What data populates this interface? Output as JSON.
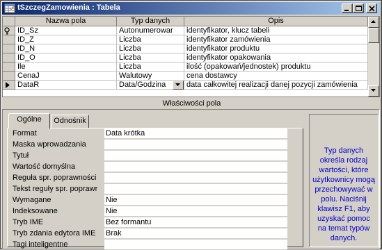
{
  "window": {
    "title": "tSzczegZamowienia : Tabela"
  },
  "grid": {
    "headers": [
      "Nazwa pola",
      "Typ danych",
      "Opis"
    ],
    "rows": [
      {
        "name": "ID_Sz",
        "type": "Autonumerowar",
        "desc": "identyfikator, klucz tabeli",
        "selector": "key-icon"
      },
      {
        "name": "ID_Z",
        "type": "Liczba",
        "desc": "identyfikator zamówienia",
        "selector": ""
      },
      {
        "name": "ID_N",
        "type": "Liczba",
        "desc": "identyfikator produktu",
        "selector": ""
      },
      {
        "name": "ID_O",
        "type": "Liczba",
        "desc": "identyfikator opakowania",
        "selector": ""
      },
      {
        "name": "Ile",
        "type": "Liczba",
        "desc": "ilość (opakowań/jednostek) produktu",
        "selector": ""
      },
      {
        "name": "CenaJ",
        "type": "Walutowy",
        "desc": "cena dostawcy",
        "selector": ""
      },
      {
        "name": "DataR",
        "type": "Data/Godzina",
        "desc": "data całkowitej realizacji danej pozycji zamówienia",
        "selector": "current-row-arrow-icon"
      }
    ]
  },
  "properties": {
    "section_label": "Właściwości pola",
    "tabs": [
      "Ogólne",
      "Odnośnik"
    ],
    "active_tab": "Ogólne",
    "items": [
      {
        "label": "Format",
        "value": "Data krótka"
      },
      {
        "label": "Maska wprowadzania",
        "value": ""
      },
      {
        "label": "Tytuł",
        "value": ""
      },
      {
        "label": "Wartość domyślna",
        "value": ""
      },
      {
        "label": "Reguła spr. poprawności",
        "value": ""
      },
      {
        "label": "Tekst reguły spr. poprawr",
        "value": ""
      },
      {
        "label": "Wymagane",
        "value": "Nie"
      },
      {
        "label": "Indeksowane",
        "value": "Nie"
      },
      {
        "label": "Tryb IME",
        "value": "Bez formantu"
      },
      {
        "label": "Tryb zdania edytora IME",
        "value": "Brak"
      },
      {
        "label": "Tagi inteligentne",
        "value": ""
      }
    ],
    "help_text": "Typ danych określa rodzaj wartości, które użytkownicy mogą przechowywać w polu. Naciśnij klawisz F1, aby uzyskać pomoc na temat typów danych."
  },
  "colors": {
    "titlebar_start": "#0a246a",
    "titlebar_end": "#a6caf0",
    "help_text": "#0000cc",
    "face": "#d4d0c8"
  }
}
